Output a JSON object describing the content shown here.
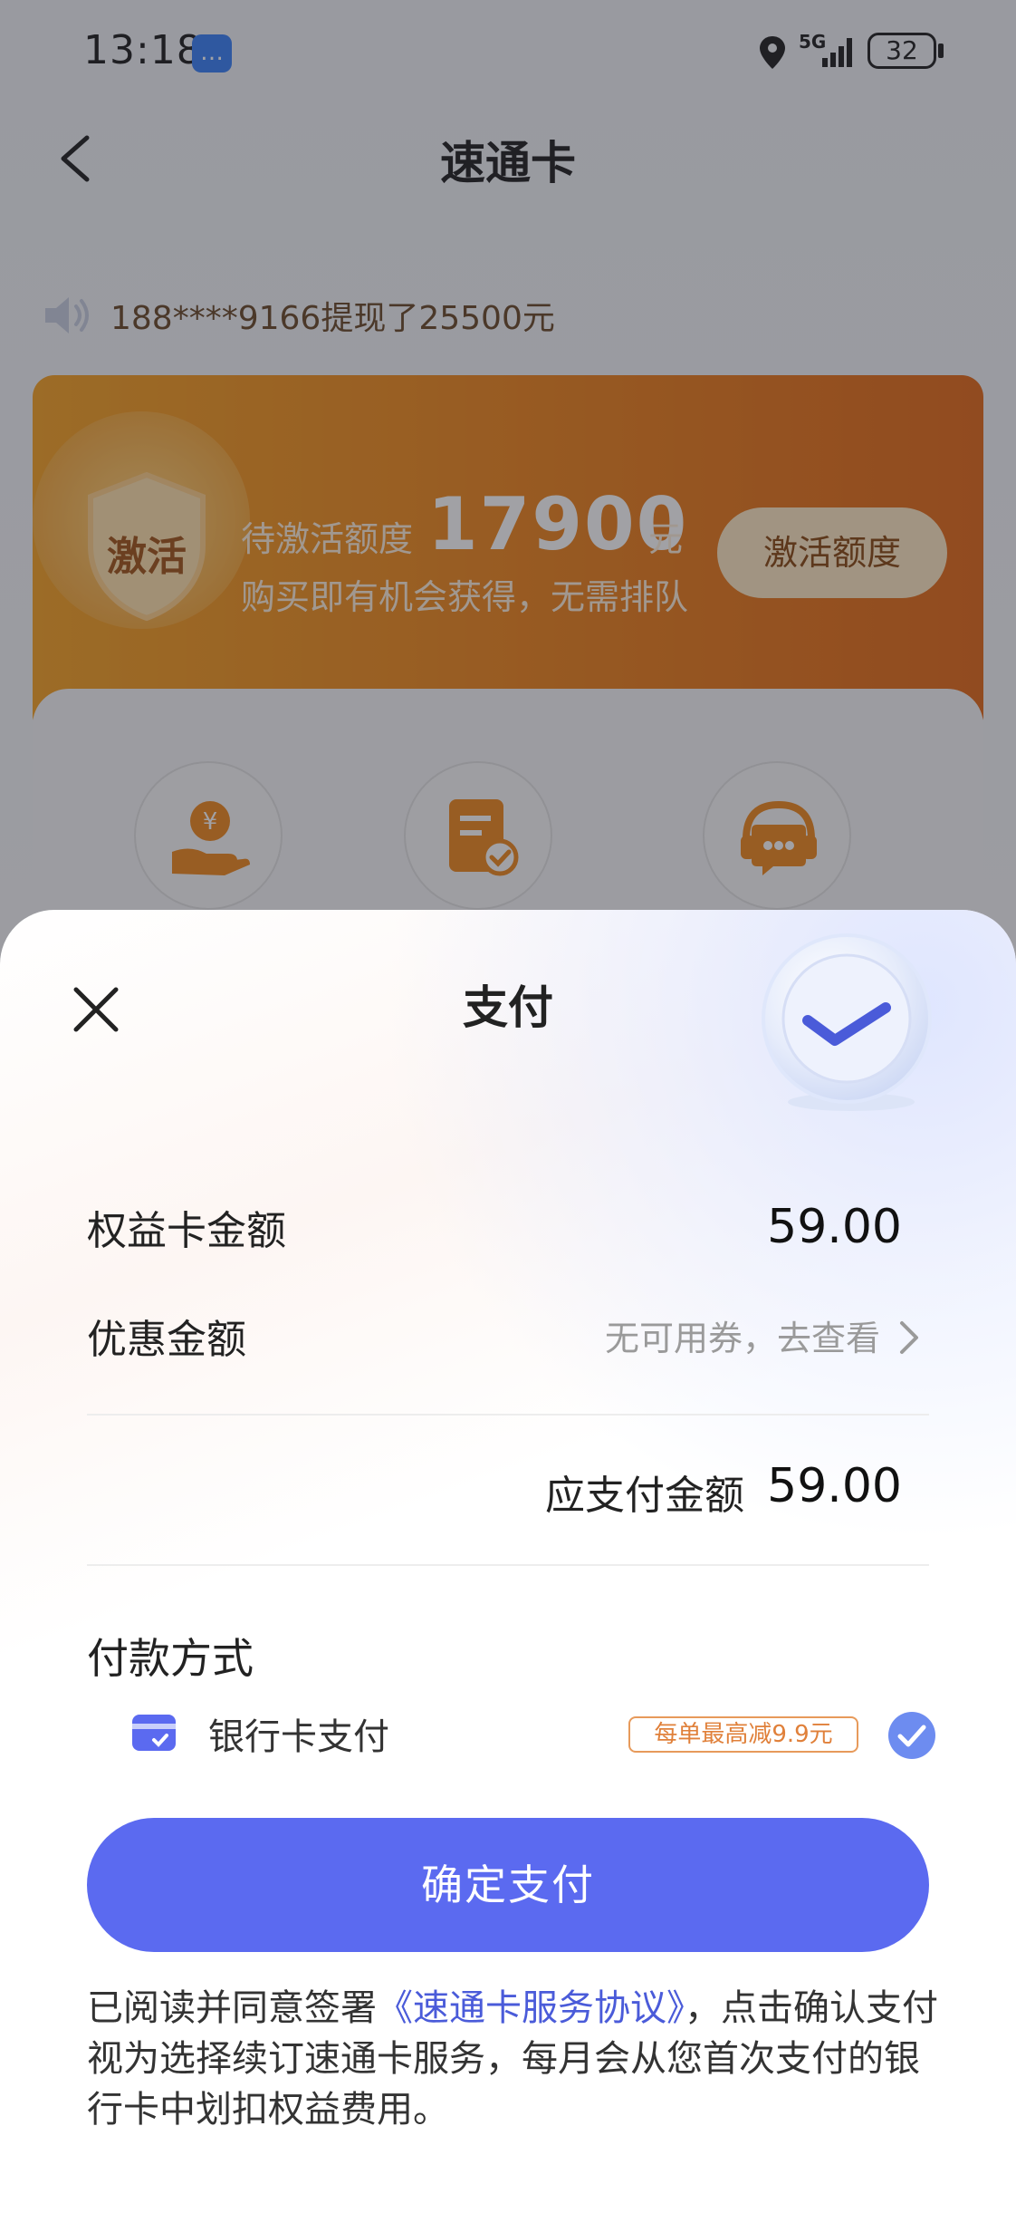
{
  "status_bar": {
    "time": "13:18",
    "network": "5G",
    "battery": "32"
  },
  "nav": {
    "title": "速通卡"
  },
  "notice": {
    "text": "188****9166提现了25500元"
  },
  "promo": {
    "shield_text": "激活",
    "quota_label": "待激活额度",
    "quota_amount": "17900",
    "quota_unit": "元",
    "subtitle": "购买即有机会获得，无需排队",
    "button_label": "激活额度"
  },
  "payment_sheet": {
    "title": "支付",
    "card_amount_label": "权益卡金额",
    "card_amount_value": "59.00",
    "discount_label": "优惠金额",
    "discount_value": "无可用券，去查看",
    "payable_label": "应支付金额",
    "payable_value": "59.00",
    "method_title": "付款方式",
    "method_bank_label": "银行卡支付",
    "method_discount_tag": "每单最高减9.9元",
    "confirm_button": "确定支付",
    "agreement_prefix": "已阅读并同意签署",
    "agreement_link": "《速通卡服务协议》",
    "agreement_suffix": "，点击确认支付视为选择续订速通卡服务，每月会从您首次支付的银行卡中划扣权益费用。"
  },
  "colors": {
    "accent": "#5b6af0",
    "promo_orange": "#f08a1f",
    "tag_orange": "#e0803a",
    "link_blue": "#4a5bd9"
  },
  "icons": [
    "message-icon",
    "location-icon",
    "signal-icon",
    "back-arrow-icon",
    "speaker-icon",
    "shield-icon",
    "coin-hand-icon",
    "document-check-icon",
    "customer-service-icon",
    "close-icon",
    "check-badge-icon",
    "chevron-right-icon",
    "bank-card-icon",
    "checkmark-icon"
  ]
}
